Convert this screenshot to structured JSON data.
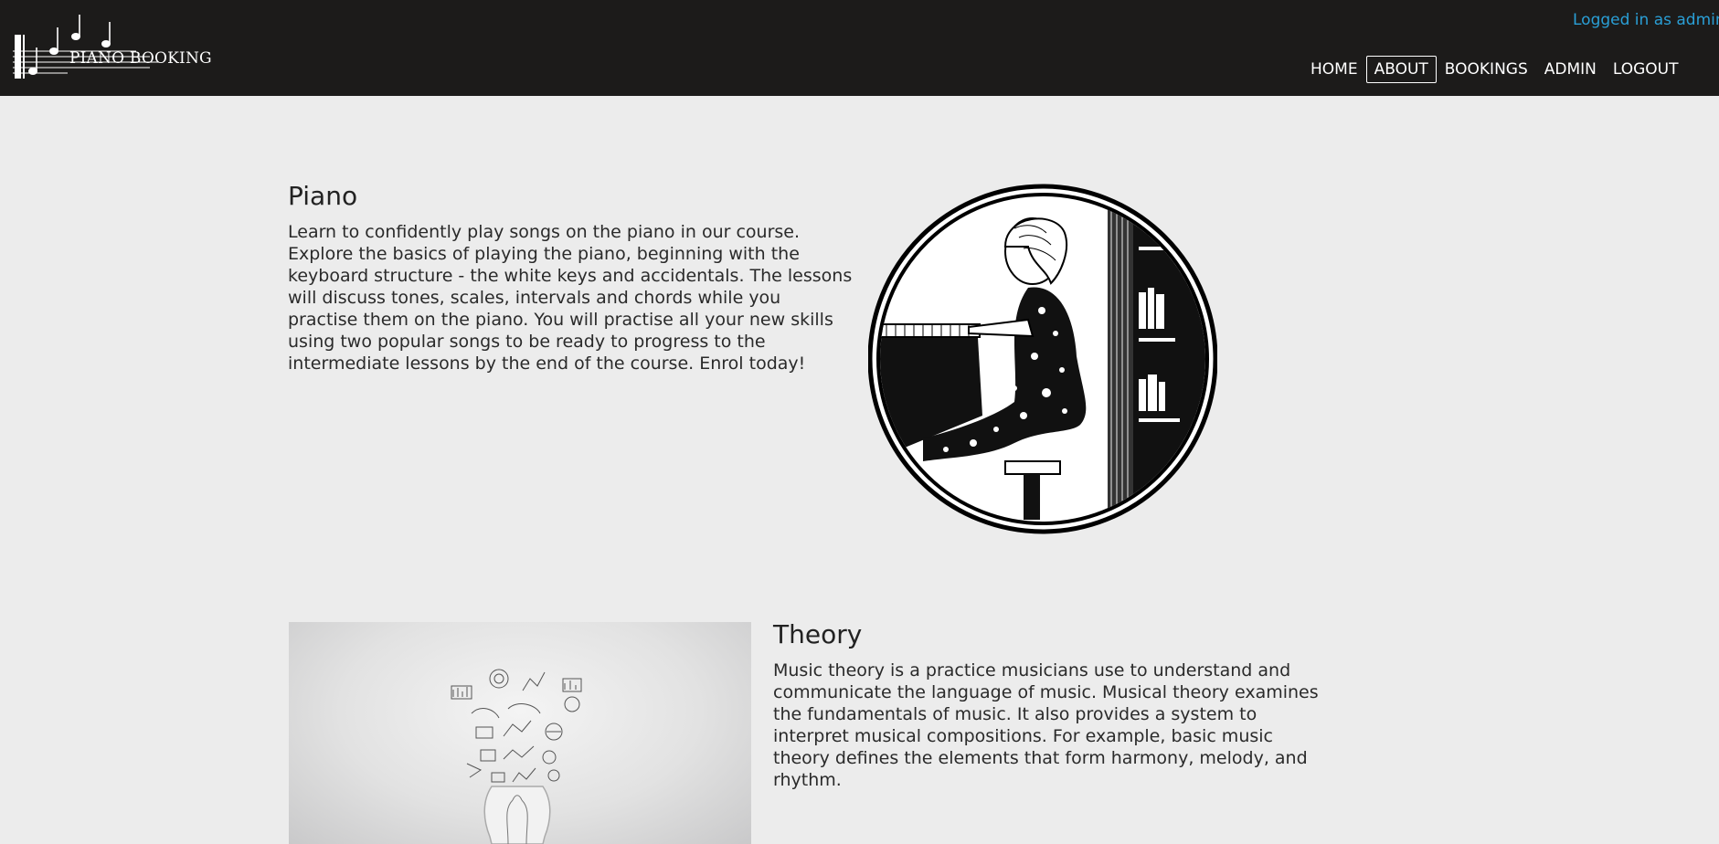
{
  "header": {
    "logo_text": "PIANO BOOKING",
    "logged_in_text": "Logged in as admin",
    "nav": [
      {
        "label": "HOME",
        "active": false
      },
      {
        "label": "ABOUT",
        "active": true
      },
      {
        "label": "BOOKINGS",
        "active": false
      },
      {
        "label": "ADMIN",
        "active": false
      },
      {
        "label": "LOGOUT",
        "active": false
      }
    ]
  },
  "sections": {
    "piano": {
      "title": "Piano",
      "body": "Learn to confidently play songs on the piano in our course. Explore the basics of playing the piano, beginning with the keyboard structure - the white keys and accidentals. The lessons will discuss tones, scales, intervals and chords while you practise them on the piano. You will practise all your new skills using two popular songs to be ready to progress to the intermediate lessons by the end of the course. Enrol today!",
      "image_icon": "woman-playing-piano-illustration"
    },
    "theory": {
      "title": "Theory",
      "body": "Music theory is a practice musicians use to understand and communicate the language of music. Musical theory examines the fundamentals of music. It also provides a system to interpret musical compositions. For example, basic music theory defines the elements that form harmony, melody, and rhythm.",
      "image_icon": "lightbulb-sketch-image"
    }
  },
  "colors": {
    "header_bg": "#1c1b1a",
    "page_bg": "#ececec",
    "accent": "#2a9fd6"
  }
}
